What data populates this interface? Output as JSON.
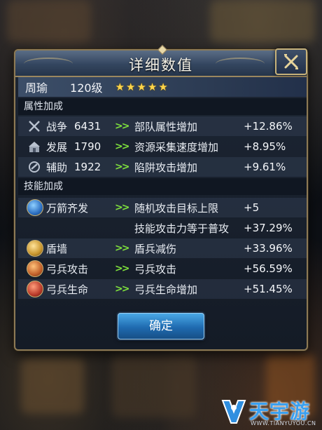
{
  "dialog": {
    "title": "详细数值",
    "confirm_label": "确定"
  },
  "hero": {
    "name": "周瑜",
    "level": "120级",
    "stars": 5
  },
  "attribute_section": {
    "header": "属性加成",
    "rows": [
      {
        "icon": "crossed-swords-icon",
        "name": "战争",
        "value": "6431",
        "effect": "部队属性增加",
        "bonus": "+12.86%"
      },
      {
        "icon": "development-icon",
        "name": "发展",
        "value": "1790",
        "effect": "资源采集速度增加",
        "bonus": "+8.95%"
      },
      {
        "icon": "assist-icon",
        "name": "辅助",
        "value": "1922",
        "effect": "陷阱攻击增加",
        "bonus": "+9.61%"
      }
    ]
  },
  "skill_section": {
    "header": "技能加成",
    "rows": [
      {
        "icon": "arrow-volley-skill-icon",
        "name": "万箭齐发",
        "effect": "随机攻击目标上限",
        "bonus": "+5",
        "color": "#2c6fc2"
      },
      {
        "icon": "",
        "name": "",
        "effect": "技能攻击力等于普攻",
        "bonus": "+37.29%"
      },
      {
        "icon": "shield-wall-skill-icon",
        "name": "盾墙",
        "effect": "盾兵减伤",
        "bonus": "+33.96%",
        "color": "#c9962e"
      },
      {
        "icon": "archer-attack-skill-icon",
        "name": "弓兵攻击",
        "effect": "弓兵攻击",
        "bonus": "+56.59%",
        "color": "#c0602a"
      },
      {
        "icon": "archer-life-skill-icon",
        "name": "弓兵生命",
        "effect": "弓兵生命增加",
        "bonus": "+51.45%",
        "color": "#b83a2a"
      }
    ]
  },
  "watermark": {
    "text": "天宇游",
    "url": "WWW.TIANYUYOU.CN"
  }
}
